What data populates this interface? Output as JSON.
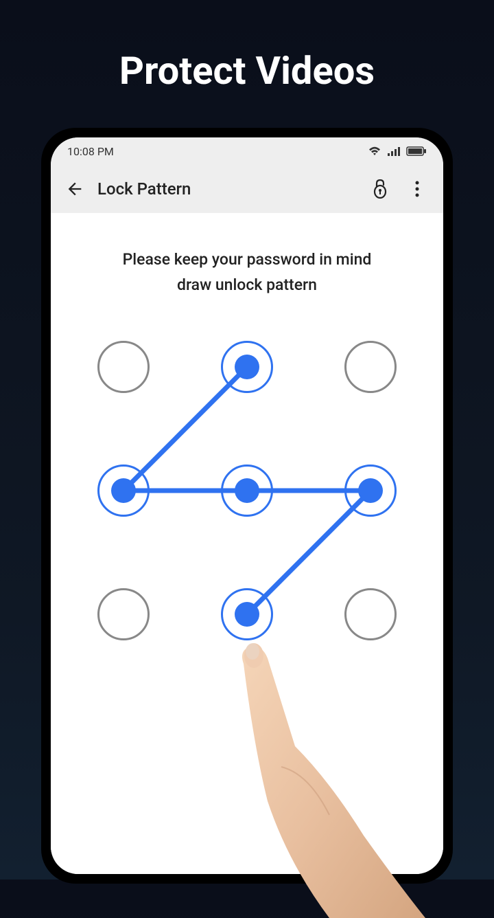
{
  "page": {
    "title": "Protect Videos"
  },
  "status_bar": {
    "time": "10:08 PM"
  },
  "app_bar": {
    "title": "Lock Pattern"
  },
  "content": {
    "instruction_line1": "Please keep your password in mind",
    "instruction_line2": "draw unlock pattern"
  },
  "pattern": {
    "grid_size": 3,
    "active_dots": [
      2,
      4,
      5,
      6,
      8
    ],
    "path_sequence": [
      2,
      4,
      5,
      6,
      8
    ],
    "colors": {
      "active": "#2f72f0",
      "inactive": "#888888",
      "line": "#2f72f0"
    }
  }
}
